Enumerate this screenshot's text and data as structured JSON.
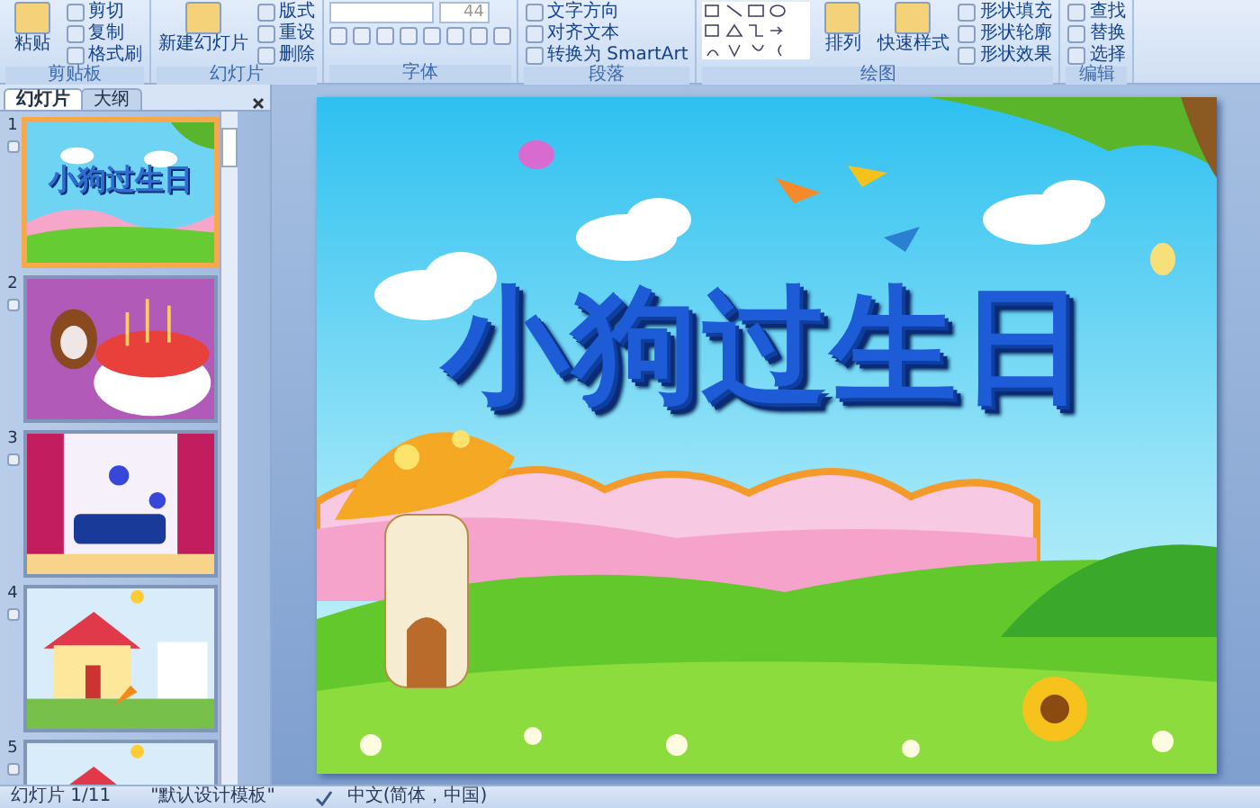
{
  "ribbon": {
    "groups": [
      {
        "label": "剪贴板",
        "items": [
          {
            "kind": "large",
            "label": "粘贴"
          },
          {
            "kind": "small",
            "label": "剪切"
          },
          {
            "kind": "small",
            "label": "复制"
          },
          {
            "kind": "small",
            "label": "格式刷"
          }
        ]
      },
      {
        "label": "幻灯片",
        "items": [
          {
            "kind": "large",
            "label": "新建幻灯片"
          },
          {
            "kind": "small",
            "label": "版式"
          },
          {
            "kind": "small",
            "label": "重设"
          },
          {
            "kind": "small",
            "label": "删除"
          }
        ]
      },
      {
        "label": "字体",
        "items": [
          {
            "kind": "field",
            "value": "44"
          }
        ]
      },
      {
        "label": "段落",
        "items": [
          {
            "kind": "small",
            "label": "文字方向"
          },
          {
            "kind": "small",
            "label": "对齐文本"
          },
          {
            "kind": "small",
            "label": "转换为 SmartArt"
          }
        ]
      },
      {
        "label": "绘图",
        "items": [
          {
            "kind": "shapes"
          },
          {
            "kind": "large",
            "label": "排列"
          },
          {
            "kind": "large",
            "label": "快速样式"
          },
          {
            "kind": "small",
            "label": "形状填充"
          },
          {
            "kind": "small",
            "label": "形状轮廓"
          },
          {
            "kind": "small",
            "label": "形状效果"
          }
        ]
      },
      {
        "label": "编辑",
        "items": [
          {
            "kind": "small",
            "label": "查找"
          },
          {
            "kind": "small",
            "label": "替换"
          },
          {
            "kind": "small",
            "label": "选择"
          }
        ]
      }
    ]
  },
  "pane": {
    "tabs": [
      {
        "label": "幻灯片",
        "selected": true
      },
      {
        "label": "大纲",
        "selected": false
      }
    ],
    "slides": [
      {
        "number": "1",
        "selected": true,
        "kind": "title",
        "title": "小狗过生日"
      },
      {
        "number": "2",
        "selected": false,
        "kind": "cake"
      },
      {
        "number": "3",
        "selected": false,
        "kind": "room"
      },
      {
        "number": "4",
        "selected": false,
        "kind": "house"
      },
      {
        "number": "5",
        "selected": false,
        "kind": "house"
      }
    ]
  },
  "slide": {
    "title": "小狗过生日"
  },
  "status_bar": {
    "slide": "幻灯片 1/11",
    "theme": "\"默认设计模板\"",
    "language": "中文(简体，中国)"
  }
}
